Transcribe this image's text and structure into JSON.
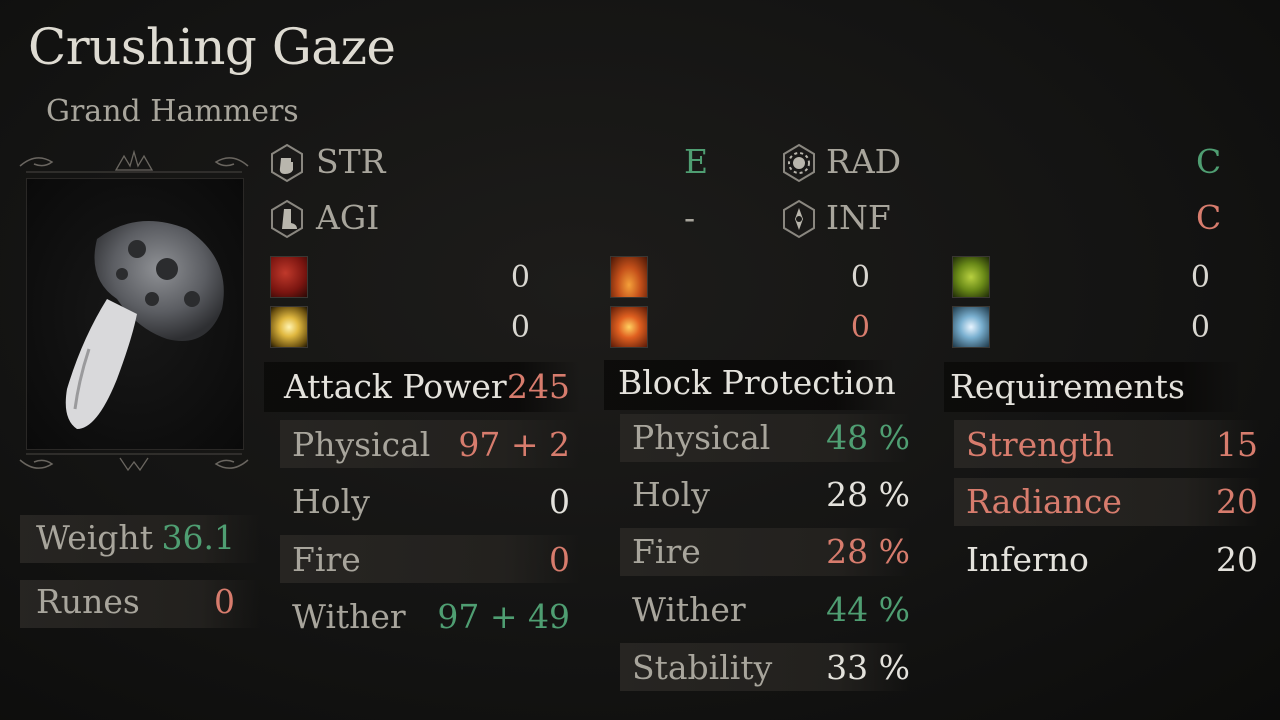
{
  "item": {
    "name": "Crushing Gaze",
    "category": "Grand Hammers"
  },
  "scaling": [
    {
      "attr": "STR",
      "grade": "E",
      "icon": "fist-icon",
      "color": "#4f9e72"
    },
    {
      "attr": "AGI",
      "grade": "-",
      "icon": "boot-icon",
      "color": "#a8a59c"
    },
    {
      "attr": "RAD",
      "grade": "C",
      "icon": "sun-icon",
      "color": "#4f9e72"
    },
    {
      "attr": "INF",
      "grade": "C",
      "icon": "compass-icon",
      "color": "#d77c6d"
    }
  ],
  "effects": [
    {
      "icon": "bleed-icon",
      "value": "0"
    },
    {
      "icon": "lightning-icon",
      "value": "0"
    },
    {
      "icon": "flame-icon",
      "value": "0"
    },
    {
      "icon": "fire-burst-icon",
      "value": "0"
    },
    {
      "icon": "poison-icon",
      "value": "0"
    },
    {
      "icon": "frost-icon",
      "value": "0"
    }
  ],
  "attack_power": {
    "label": "Attack Power",
    "total": "245",
    "rows": [
      {
        "label": "Physical",
        "value": "97 + 2",
        "color": "#d77c6d"
      },
      {
        "label": "Holy",
        "value": "0",
        "color": "#e4e2dc"
      },
      {
        "label": "Fire",
        "value": "0",
        "color": "#d77c6d"
      },
      {
        "label": "Wither",
        "value": "97 + 49",
        "color": "#4f9e72"
      }
    ]
  },
  "block_protection": {
    "label": "Block Protection",
    "rows": [
      {
        "label": "Physical",
        "value": "48 %",
        "color": "#4f9e72"
      },
      {
        "label": "Holy",
        "value": "28 %",
        "color": "#e4e2dc"
      },
      {
        "label": "Fire",
        "value": "28 %",
        "color": "#d77c6d"
      },
      {
        "label": "Wither",
        "value": "44 %",
        "color": "#4f9e72"
      },
      {
        "label": "Stability",
        "value": "33 %",
        "color": "#e4e2dc"
      }
    ]
  },
  "requirements": {
    "label": "Requirements",
    "rows": [
      {
        "label": "Strength",
        "value": "15",
        "color": "#d77c6d"
      },
      {
        "label": "Radiance",
        "value": "20",
        "color": "#d77c6d"
      },
      {
        "label": "Inferno",
        "value": "20",
        "color": "#e4e2dc"
      }
    ]
  },
  "weight": {
    "label": "Weight",
    "value": "36.1"
  },
  "runes": {
    "label": "Runes",
    "value": "0"
  }
}
